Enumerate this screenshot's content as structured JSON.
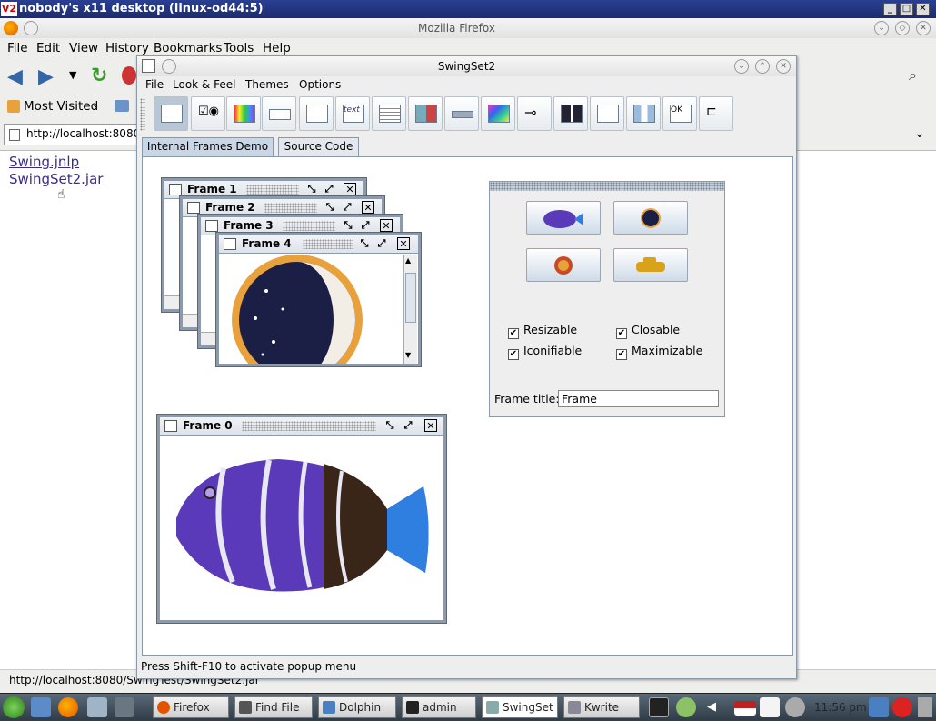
{
  "vnc": {
    "title": "nobody's x11 desktop (linux-od44:5)",
    "logo": "V2"
  },
  "firefox": {
    "window_title": "Mozilla Firefox",
    "menu": [
      "File",
      "Edit",
      "View",
      "History",
      "Bookmarks",
      "Tools",
      "Help"
    ],
    "bookmarks": {
      "most_visited": "Most Visited"
    },
    "url": "http://localhost:8080/",
    "links": [
      "Swing.jnlp",
      "SwingSet2.jar"
    ],
    "status": "http://localhost:8080/SwingTest/SwingSet2.jar"
  },
  "swingset": {
    "title": "SwingSet2",
    "menu": [
      "File",
      "Look & Feel",
      "Themes",
      "Options"
    ],
    "toolbar_icons": [
      "internal-frame-icon",
      "checkbox-radio-icon",
      "color-chooser-icon",
      "combobox-icon",
      "file-chooser-icon",
      "text-editor-icon",
      "list-icon",
      "option-pane-icon",
      "progress-bar-icon",
      "scroll-pane-icon",
      "slider-icon",
      "split-pane-icon",
      "tabbed-pane-icon",
      "table-icon",
      "tooltip-icon",
      "tree-icon"
    ],
    "tabs": [
      "Internal Frames Demo",
      "Source Code"
    ],
    "frames": [
      "Frame 0",
      "Frame 1",
      "Frame 2",
      "Frame 3",
      "Frame 4"
    ],
    "checkboxes": [
      {
        "label": "Resizable",
        "checked": true
      },
      {
        "label": "Closable",
        "checked": true
      },
      {
        "label": "Iconifiable",
        "checked": true
      },
      {
        "label": "Maximizable",
        "checked": true
      }
    ],
    "frame_title_label": "Frame title:",
    "frame_title_value": "Frame",
    "status": "Press Shift-F10 to activate popup menu"
  },
  "taskbar": {
    "tasks": [
      "Firefox",
      "Find File",
      "Dolphin",
      "admin",
      "SwingSet",
      "Kwrite"
    ],
    "clock": "11:56 pm"
  },
  "colors": {
    "accent": "#2a3f93",
    "frame_border": "#8d9aac",
    "link": "#3a2a8f"
  }
}
